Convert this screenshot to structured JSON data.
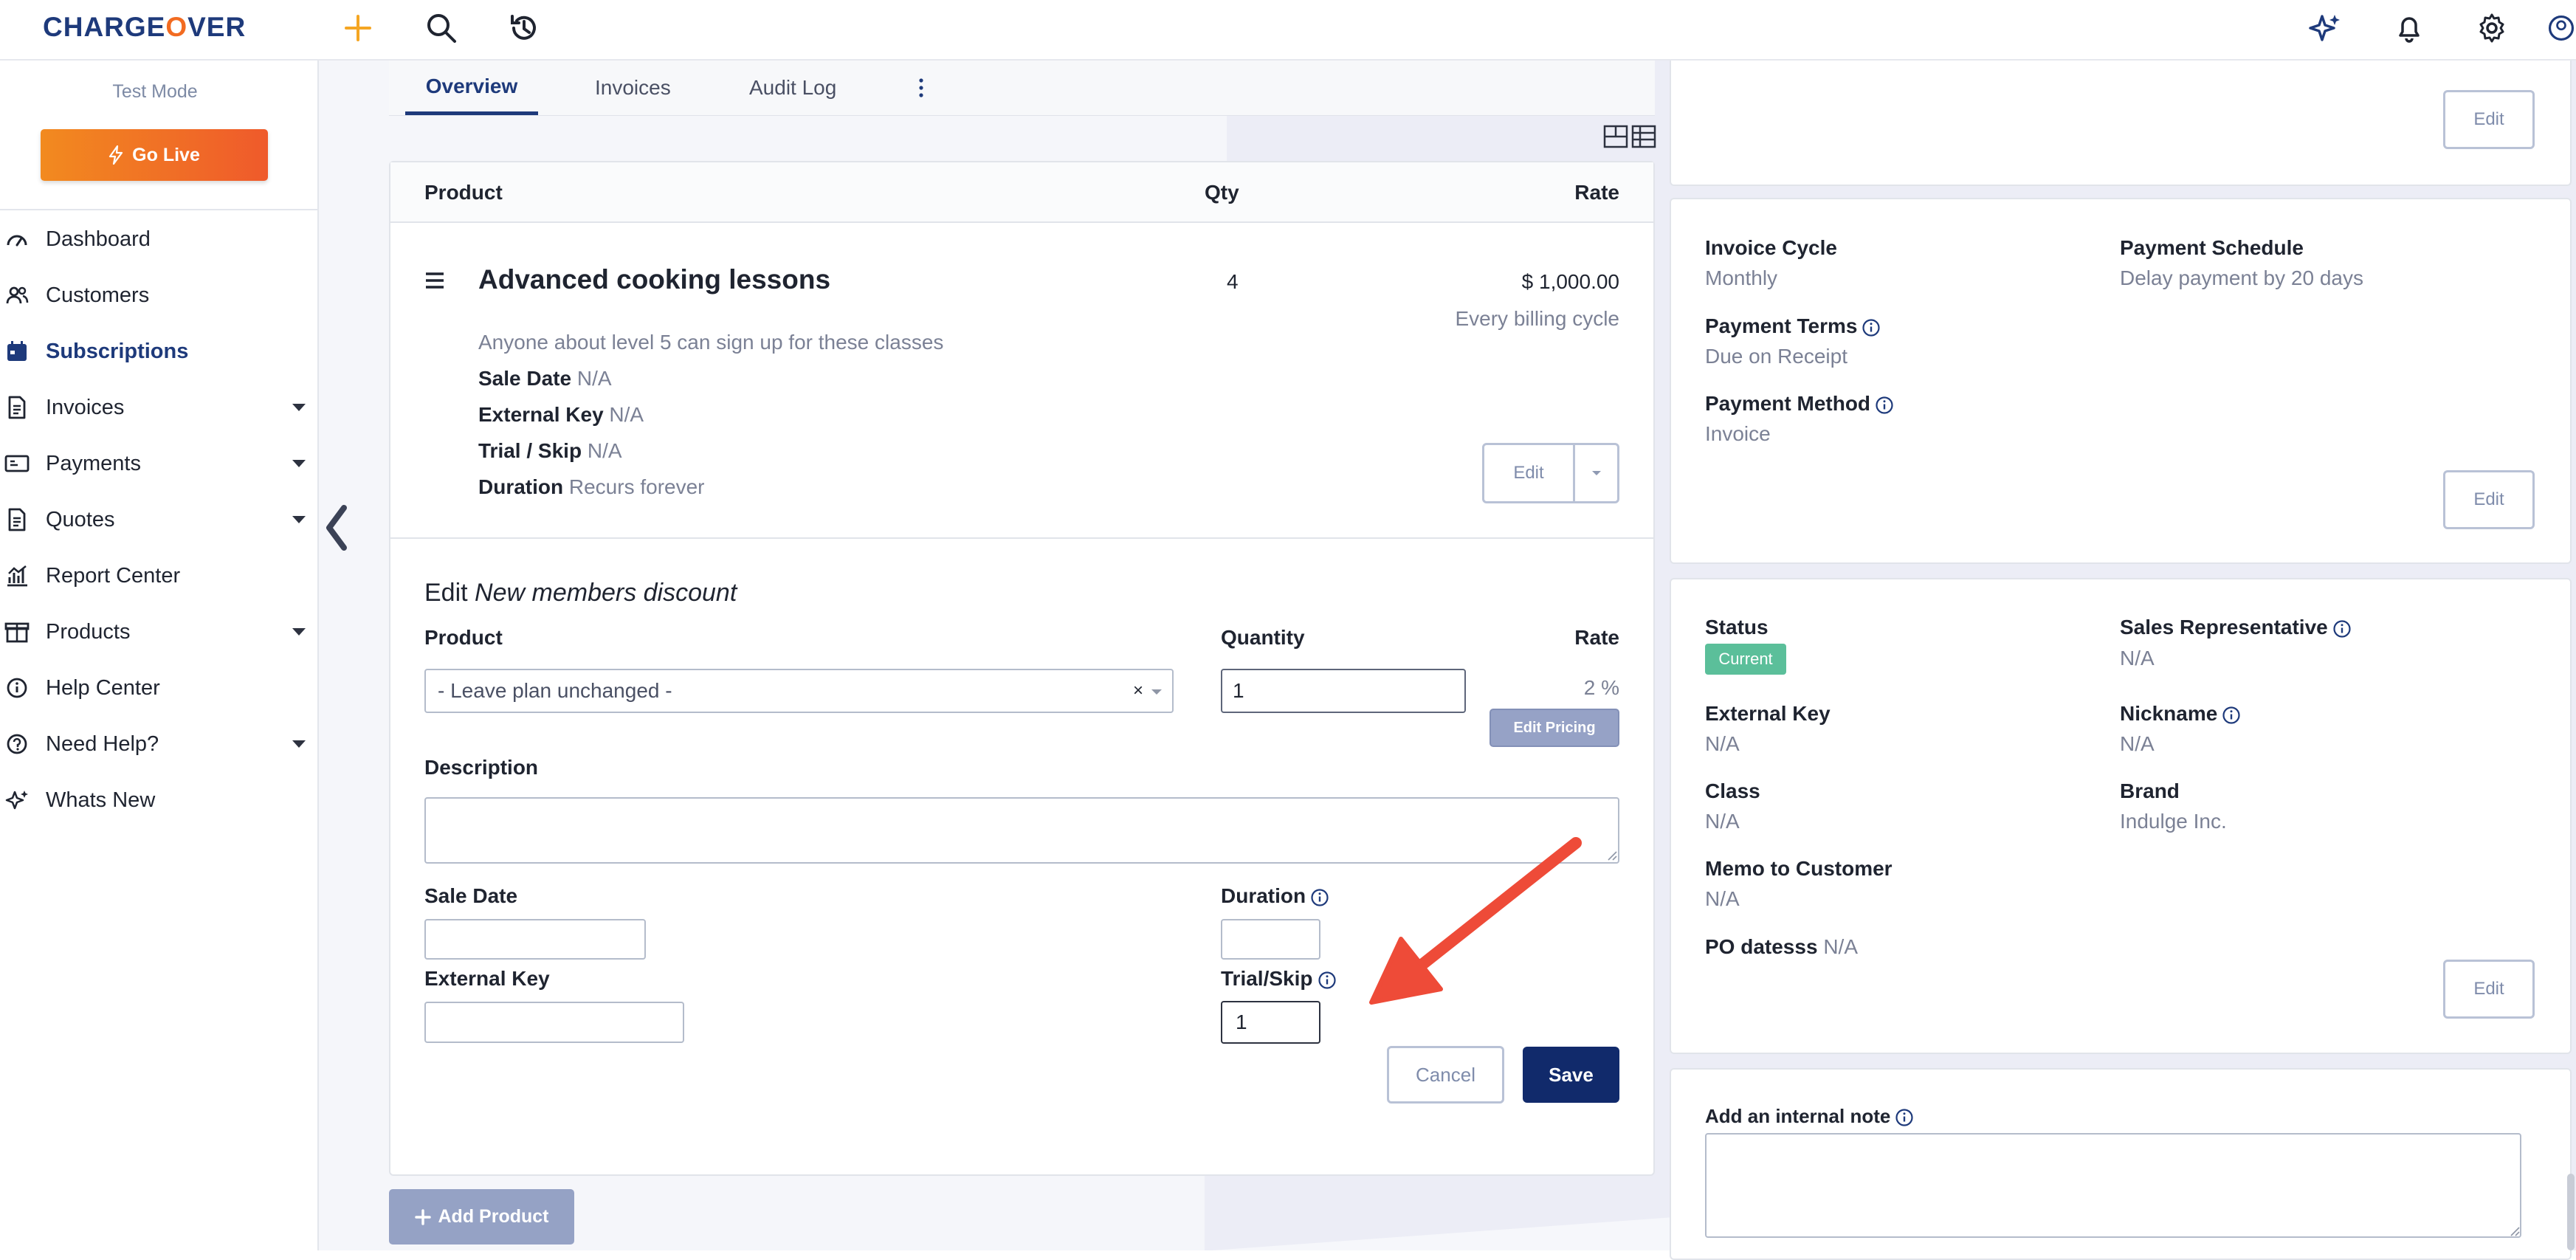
{
  "app": {
    "logo_part1": "CHARGE",
    "logo_o": "O",
    "logo_part2": "VER"
  },
  "sidebar": {
    "test_mode": "Test Mode",
    "go_live": "Go Live",
    "items": [
      {
        "label": "Dashboard",
        "icon": "gauge-icon"
      },
      {
        "label": "Customers",
        "icon": "users-icon"
      },
      {
        "label": "Subscriptions",
        "icon": "calendar-icon",
        "active": true
      },
      {
        "label": "Invoices",
        "icon": "document-icon",
        "caret": true
      },
      {
        "label": "Payments",
        "icon": "money-icon",
        "caret": true
      },
      {
        "label": "Quotes",
        "icon": "document-icon",
        "caret": true
      },
      {
        "label": "Report Center",
        "icon": "chart-icon"
      },
      {
        "label": "Products",
        "icon": "box-icon",
        "caret": true
      },
      {
        "label": "Help Center",
        "icon": "info-icon"
      },
      {
        "label": "Need Help?",
        "icon": "question-icon",
        "caret": true
      },
      {
        "label": "Whats New",
        "icon": "sparkle-icon"
      }
    ]
  },
  "tabs": {
    "overview": "Overview",
    "invoices": "Invoices",
    "audit_log": "Audit Log"
  },
  "product_table": {
    "col_product": "Product",
    "col_qty": "Qty",
    "col_rate": "Rate",
    "line": {
      "name": "Advanced cooking lessons",
      "qty": "4",
      "rate": "$ 1,000.00",
      "cycle": "Every billing cycle",
      "description": "Anyone about level 5 can sign up for these classes",
      "sale_date_label": "Sale Date",
      "sale_date_value": "N/A",
      "external_key_label": "External Key",
      "external_key_value": "N/A",
      "trial_label": "Trial / Skip",
      "trial_value": "N/A",
      "duration_label": "Duration",
      "duration_value": "Recurs forever",
      "edit": "Edit"
    }
  },
  "edit_form": {
    "title_prefix": "Edit",
    "title_name": "New members discount",
    "product_label": "Product",
    "product_value": "- Leave plan unchanged -",
    "quantity_label": "Quantity",
    "quantity_value": "1",
    "rate_label": "Rate",
    "rate_value": "2 %",
    "edit_pricing": "Edit Pricing",
    "description_label": "Description",
    "sale_date_label": "Sale Date",
    "duration_label": "Duration",
    "external_key_label": "External Key",
    "trial_label": "Trial/Skip",
    "trial_value": "1",
    "cancel": "Cancel",
    "save": "Save"
  },
  "add_product": "Add Product",
  "right": {
    "top_edit": "Edit",
    "billing": {
      "invoice_cycle_label": "Invoice Cycle",
      "invoice_cycle": "Monthly",
      "payment_schedule_label": "Payment Schedule",
      "payment_schedule": "Delay payment by 20 days",
      "payment_terms_label": "Payment Terms",
      "payment_terms": "Due on Receipt",
      "payment_method_label": "Payment Method",
      "payment_method": "Invoice",
      "edit": "Edit"
    },
    "details": {
      "status_label": "Status",
      "status": "Current",
      "sales_rep_label": "Sales Representative",
      "sales_rep": "N/A",
      "external_key_label": "External Key",
      "external_key": "N/A",
      "nickname_label": "Nickname",
      "nickname": "N/A",
      "class_label": "Class",
      "class": "N/A",
      "brand_label": "Brand",
      "brand": "Indulge Inc.",
      "memo_label": "Memo to Customer",
      "memo": "N/A",
      "po_label": "PO datesss",
      "po": "N/A",
      "edit": "Edit"
    },
    "note_label": "Add an internal note"
  },
  "colors": {
    "brand": "#1e3a7b",
    "orange": "#f26b21",
    "status": "#5bbf9a",
    "arrow": "#ee4b38"
  }
}
